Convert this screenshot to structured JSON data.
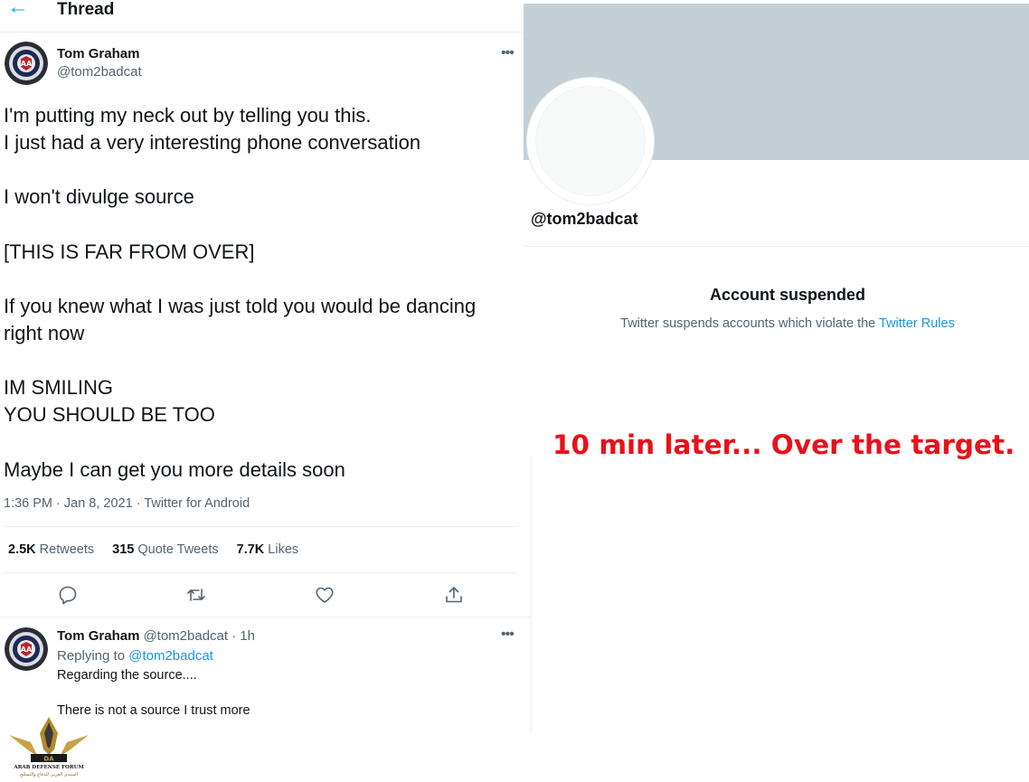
{
  "thread": {
    "back_icon": "arrow-left-icon",
    "title": "Thread",
    "main_tweet": {
      "author_name": "Tom Graham",
      "author_handle": "@tom2badcat",
      "more_icon": "more-horizontal-icon",
      "lines": [
        "I'm putting my neck out by telling you this.",
        "I just had a very interesting phone conversation",
        "",
        "I won't divulge source",
        "",
        "[THIS IS FAR FROM OVER]",
        "",
        "If you knew what I was just told you would be dancing",
        "right now",
        "",
        "IM SMILING",
        "YOU SHOULD BE TOO",
        "",
        "Maybe I can get you more details soon"
      ],
      "meta": "1:36 PM · Jan 8, 2021 · Twitter for Android",
      "stats": {
        "retweets_count": "2.5K",
        "retweets_label": "Retweets",
        "quotes_count": "315",
        "quotes_label": "Quote Tweets",
        "likes_count": "7.7K",
        "likes_label": "Likes"
      },
      "actions": [
        "reply-icon",
        "retweet-icon",
        "like-icon",
        "share-icon"
      ]
    },
    "reply_tweet": {
      "author_name": "Tom Graham",
      "author_handle": "@tom2badcat",
      "time": "· 1h",
      "replying_label": "Replying to",
      "replying_handle": "@tom2badcat",
      "line1": "Regarding the source....",
      "line2": "There is not a source I trust more"
    }
  },
  "profile": {
    "handle": "@tom2badcat",
    "suspended_title": "Account suspended",
    "suspended_desc": "Twitter suspends accounts which violate the",
    "rules_link": "Twitter Rules"
  },
  "caption": "10 min later... Over the target.",
  "watermark": {
    "logo_text": "ARAB DEFENSE FORUM",
    "logo_initials": "DA",
    "logo_arabic": "المنتدى العربي للدفاع والتسليح"
  },
  "colors": {
    "accent": "#1da1f2",
    "caption": "#e8111a",
    "banner": "#c4cfd6",
    "muted": "#536471"
  }
}
